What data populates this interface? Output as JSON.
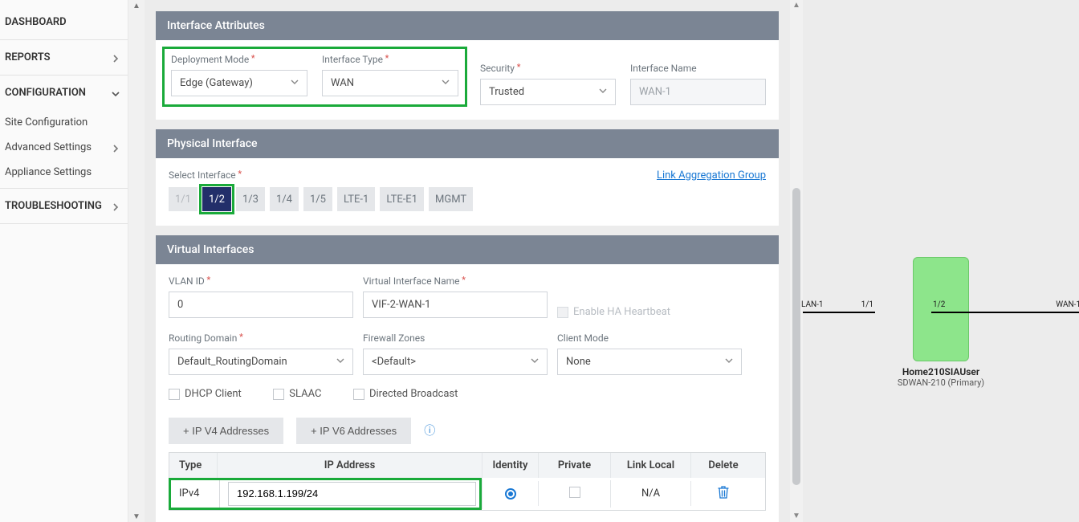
{
  "nav": {
    "dashboard": "DASHBOARD",
    "reports": "REPORTS",
    "configuration": "CONFIGURATION",
    "site_configuration": "Site Configuration",
    "advanced_settings": "Advanced Settings",
    "appliance_settings": "Appliance Settings",
    "troubleshooting": "TROUBLESHOOTING"
  },
  "sections": {
    "interface_attributes": "Interface Attributes",
    "physical_interface": "Physical Interface",
    "virtual_interfaces": "Virtual Interfaces"
  },
  "interface_attributes": {
    "deployment_mode_label": "Deployment Mode",
    "deployment_mode_value": "Edge (Gateway)",
    "interface_type_label": "Interface Type",
    "interface_type_value": "WAN",
    "security_label": "Security",
    "security_value": "Trusted",
    "interface_name_label": "Interface Name",
    "interface_name_value": "WAN-1"
  },
  "physical_interface": {
    "select_label": "Select Interface",
    "link_agg": "Link Aggregation Group",
    "ifaces": {
      "i1": "1/1",
      "i2": "1/2",
      "i3": "1/3",
      "i4": "1/4",
      "i5": "1/5",
      "lte1": "LTE-1",
      "ltee1": "LTE-E1",
      "mgmt": "MGMT"
    }
  },
  "virtual_interfaces": {
    "vlan_label": "VLAN ID",
    "vlan_value": "0",
    "vif_name_label": "Virtual Interface Name",
    "vif_name_value": "VIF-2-WAN-1",
    "enable_ha_label": "Enable HA Heartbeat",
    "routing_domain_label": "Routing Domain",
    "routing_domain_value": "Default_RoutingDomain",
    "firewall_zones_label": "Firewall Zones",
    "firewall_zones_value": "<Default>",
    "client_mode_label": "Client Mode",
    "client_mode_value": "None",
    "dhcp_client_label": "DHCP Client",
    "slaac_label": "SLAAC",
    "directed_broadcast_label": "Directed Broadcast",
    "ipv4_btn": "+ IP V4 Addresses",
    "ipv6_btn": "+ IP V6 Addresses"
  },
  "ip_table": {
    "headers": {
      "type": "Type",
      "ip": "IP Address",
      "identity": "Identity",
      "private": "Private",
      "link_local": "Link Local",
      "delete": "Delete"
    },
    "row": {
      "type": "IPv4",
      "ip": "192.168.1.199/24",
      "link_local": "N/A"
    }
  },
  "diagram": {
    "lan_label": "LAN-1",
    "p11": "1/1",
    "p12": "1/2",
    "wan_label": "WAN-1",
    "device_name": "Home210SIAUser",
    "device_model": "SDWAN-210 (Primary)"
  }
}
